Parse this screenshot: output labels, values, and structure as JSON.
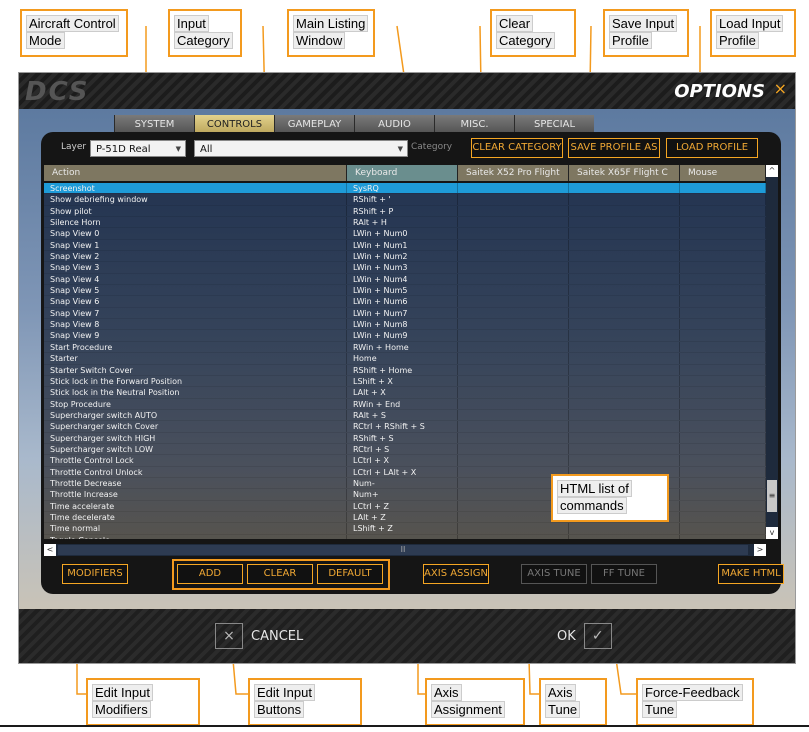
{
  "callouts": {
    "aircraft_control_mode": [
      "Aircraft Control",
      "Mode"
    ],
    "input_category": [
      "Input",
      "Category"
    ],
    "main_listing_window": [
      "Main Listing",
      "Window"
    ],
    "clear_category": [
      "Clear",
      "Category"
    ],
    "save_input_profile": [
      "Save Input",
      "Profile"
    ],
    "load_input_profile": [
      "Load Input",
      "Profile"
    ],
    "html_list": [
      "HTML list of",
      "commands"
    ],
    "edit_input_modifiers": [
      "Edit Input",
      "Modifiers"
    ],
    "edit_input_buttons": [
      "Edit Input",
      "Buttons"
    ],
    "axis_assignment": [
      "Axis",
      "Assignment"
    ],
    "axis_tune": [
      "Axis",
      "Tune"
    ],
    "force_feedback_tune": [
      "Force-Feedback",
      "Tune"
    ]
  },
  "window": {
    "logo": "DCS",
    "title": "OPTIONS",
    "close": "×"
  },
  "tabs": [
    "SYSTEM",
    "CONTROLS",
    "GAMEPLAY",
    "AUDIO",
    "MISC.",
    "SPECIAL"
  ],
  "toolbar": {
    "layer_label": "Layer",
    "layer_value": "P-51D Real",
    "category_value": "All",
    "category_label": "Category",
    "clear_category": "CLEAR CATEGORY",
    "save_profile": "SAVE PROFILE AS",
    "load_profile": "LOAD PROFILE"
  },
  "columns": [
    "Action",
    "Keyboard",
    "Saitek X52 Pro Flight",
    "Saitek X65F Flight C",
    "Mouse"
  ],
  "rows": [
    [
      "Screenshot",
      "SysRQ"
    ],
    [
      "Show debriefing window",
      "RShift + '"
    ],
    [
      "Show pilot",
      "RShift + P"
    ],
    [
      "Silence Horn",
      "RAlt + H"
    ],
    [
      "Snap View 0",
      "LWin + Num0"
    ],
    [
      "Snap View 1",
      "LWin + Num1"
    ],
    [
      "Snap View 2",
      "LWin + Num2"
    ],
    [
      "Snap View 3",
      "LWin + Num3"
    ],
    [
      "Snap View 4",
      "LWin + Num4"
    ],
    [
      "Snap View 5",
      "LWin + Num5"
    ],
    [
      "Snap View 6",
      "LWin + Num6"
    ],
    [
      "Snap View 7",
      "LWin + Num7"
    ],
    [
      "Snap View 8",
      "LWin + Num8"
    ],
    [
      "Snap View 9",
      "LWin + Num9"
    ],
    [
      "Start Procedure",
      "RWin + Home"
    ],
    [
      "Starter",
      "Home"
    ],
    [
      "Starter Switch Cover",
      "RShift + Home"
    ],
    [
      "Stick lock in the Forward Position",
      "LShift + X"
    ],
    [
      "Stick lock in the Neutral Position",
      "LAlt + X"
    ],
    [
      "Stop Procedure",
      "RWin + End"
    ],
    [
      "Supercharger switch AUTO",
      "RAlt + S"
    ],
    [
      "Supercharger switch Cover",
      "RCtrl + RShift + S"
    ],
    [
      "Supercharger switch HIGH",
      "RShift + S"
    ],
    [
      "Supercharger switch LOW",
      "RCtrl + S"
    ],
    [
      "Throttle Control Lock",
      "LCtrl + X"
    ],
    [
      "Throttle Control Unlock",
      "LCtrl + LAlt + X"
    ],
    [
      "Throttle Decrease",
      "Num-"
    ],
    [
      "Throttle Increase",
      "Num+"
    ],
    [
      "Time accelerate",
      "LCtrl + Z"
    ],
    [
      "Time decelerate",
      "LAlt + Z"
    ],
    [
      "Time normal",
      "LShift + Z"
    ],
    [
      "Toggle Console",
      ""
    ]
  ],
  "scroll": {
    "up": "^",
    "down": "v",
    "grip": "≡",
    "left": "<",
    "right": ">",
    "hgrip": "II"
  },
  "bottom": {
    "modifiers": "MODIFIERS",
    "add": "ADD",
    "clear": "CLEAR",
    "default": "DEFAULT",
    "axis_assign": "AXIS ASSIGN",
    "axis_tune": "AXIS TUNE",
    "ff_tune": "FF TUNE",
    "make_html": "MAKE HTML"
  },
  "footer": {
    "cancel": "CANCEL",
    "ok": "OK",
    "cancel_icon": "×",
    "ok_icon": "✓"
  },
  "colors": {
    "accent": "#f39a1e",
    "selected_row": "#1e9bd8",
    "active_tab": "#c9b56b"
  }
}
